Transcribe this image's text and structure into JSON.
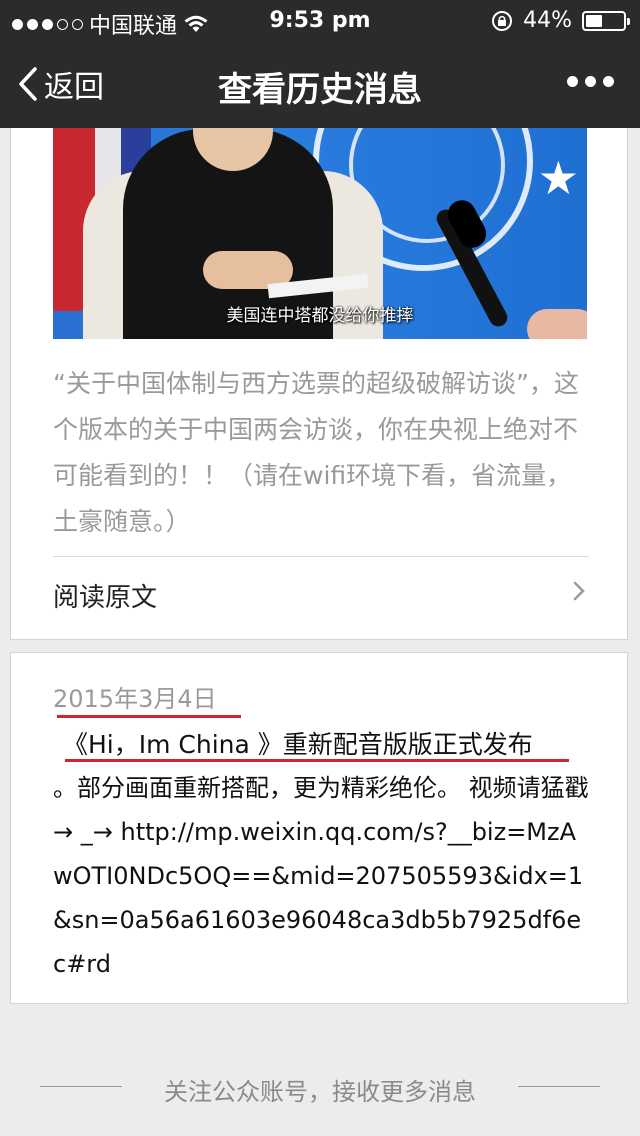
{
  "status_bar": {
    "carrier": "中国联通",
    "time": "9:53 pm",
    "battery_text": "44%",
    "battery_level": 0.44,
    "signal_bars_filled": 3,
    "signal_bars_total": 5
  },
  "nav": {
    "back_label": "返回",
    "title": "查看历史消息"
  },
  "article1": {
    "video_caption": "美国连中塔都没给你推摔",
    "description": "“关于中国体制与西方选票的超级破解访谈”，这个版本的关于中国两会访谈，你在央视上绝对不可能看到的！！（请在wifi环境下看，省流量，土豪随意。）",
    "read_more": "阅读原文"
  },
  "article2": {
    "date": "2015年3月4日",
    "headline": "《Hi，Im China 》重新配音版版正式发布",
    "body": "。部分画面重新搭配，更为精彩绝伦。 视频请猛戳→ _→ http://mp.weixin.qq.com/s?__biz=MzAwOTI0NDc5OQ==&mid=207505593&idx=1&sn=0a56a61603e96048ca3db5b7925df6ec#rd"
  },
  "footer": {
    "text": "关注公众账号，接收更多消息"
  },
  "colors": {
    "topbar_bg": "#2b2b2d",
    "accent_red": "#d0252b",
    "page_bg": "#ececec",
    "muted_text": "#9a9a9a"
  }
}
